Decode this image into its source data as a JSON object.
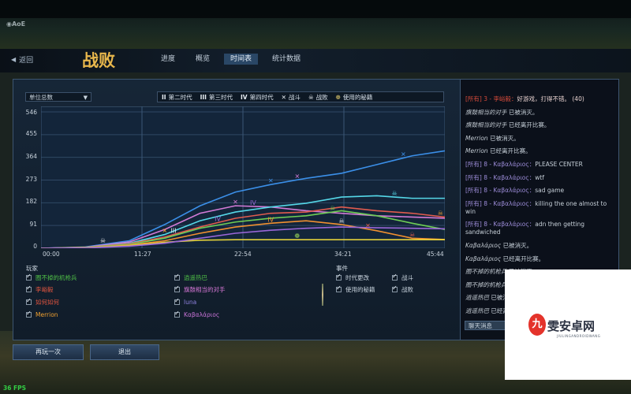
{
  "header": {
    "back_label": "返回",
    "title": "战败",
    "tabs": [
      {
        "label": "进度",
        "active": false
      },
      {
        "label": "概览",
        "active": false
      },
      {
        "label": "时间表",
        "active": true
      },
      {
        "label": "统计数据",
        "active": false
      }
    ]
  },
  "chart_controls": {
    "metric": "单位总数"
  },
  "legend": [
    {
      "glyph": "II",
      "label": "第二时代"
    },
    {
      "glyph": "III",
      "label": "第三时代"
    },
    {
      "glyph": "IV",
      "label": "第四时代"
    },
    {
      "glyph": "✕",
      "label": "战斗"
    },
    {
      "glyph": "☠",
      "label": "战败"
    },
    {
      "glyph": "❁",
      "label": "使用的秘籍"
    }
  ],
  "chart_data": {
    "type": "line",
    "x_ticks": [
      "00:00",
      "11:27",
      "22:54",
      "34:21",
      "45:44"
    ],
    "y_ticks": [
      0,
      91,
      182,
      273,
      364,
      455,
      546
    ],
    "xlim": [
      "00:00",
      "45:44"
    ],
    "ylim": [
      0,
      546
    ],
    "x_minutes": [
      0,
      5,
      10,
      14,
      18,
      22,
      26,
      30,
      34,
      38,
      42,
      45.7
    ],
    "series": [
      {
        "name": "Merrion",
        "color": "#3b8fe8",
        "values": [
          0,
          5,
          30,
          95,
          170,
          225,
          255,
          280,
          300,
          335,
          370,
          390
        ]
      },
      {
        "name": "Καβαλάριος",
        "color": "#d27ad6",
        "values": [
          0,
          4,
          25,
          75,
          140,
          170,
          165,
          150,
          140,
          130,
          125,
          120
        ]
      },
      {
        "name": "luna",
        "color": "#55d8e8",
        "values": [
          0,
          3,
          20,
          55,
          110,
          145,
          165,
          180,
          205,
          210,
          200,
          200
        ]
      },
      {
        "name": "旗鼓相当的对手",
        "color": "#e05b4e",
        "values": [
          0,
          3,
          18,
          45,
          85,
          120,
          140,
          145,
          165,
          150,
          140,
          125
        ]
      },
      {
        "name": "逍遥热巴",
        "color": "#6fce55",
        "values": [
          0,
          3,
          15,
          40,
          80,
          105,
          120,
          130,
          150,
          130,
          100,
          75
        ]
      },
      {
        "name": "李峪毅",
        "color": "#f09030",
        "values": [
          0,
          2,
          12,
          30,
          60,
          85,
          100,
          110,
          95,
          70,
          40,
          35
        ]
      },
      {
        "name": "如何如何",
        "color": "#e3d13a",
        "values": [
          0,
          2,
          10,
          24,
          32,
          34,
          34,
          34,
          34,
          34,
          34,
          34
        ]
      },
      {
        "name": "圈不掉的机枪兵",
        "color": "#9a66d8",
        "values": [
          0,
          1,
          8,
          20,
          40,
          60,
          72,
          80,
          85,
          82,
          80,
          78
        ]
      }
    ],
    "xlabel": "",
    "ylabel": "",
    "grid": true
  },
  "players_section": {
    "title": "玩家",
    "players": [
      {
        "name": "圈不掉的机枪兵",
        "color": "#4fc046"
      },
      {
        "name": "逍遥热巴",
        "color": "#4fc046"
      },
      {
        "name": "李峪毅",
        "color": "#e3553f"
      },
      {
        "name": "旗鼓相当的对手",
        "color": "#d878d8"
      },
      {
        "name": "如何如何",
        "color": "#e3553f"
      },
      {
        "name": "luna",
        "color": "#8f82e0"
      },
      {
        "name": "Merrion",
        "color": "#f0a030"
      },
      {
        "name": "Καβαλάριος",
        "color": "#c773d6"
      }
    ]
  },
  "events_section": {
    "title": "事件",
    "events": [
      {
        "label": "时代更改"
      },
      {
        "label": "战斗"
      },
      {
        "label": "使用的秘籍"
      },
      {
        "label": "战败"
      }
    ]
  },
  "buttons": {
    "replay": "再玩一次",
    "exit": "退出"
  },
  "chat": {
    "messages": [
      {
        "prefix": "[所有] 3 - 李峪毅：",
        "text": "好游戏，打得不错。 (40)",
        "style": "red"
      },
      {
        "name": "旗鼓相当的对手",
        "text": "已被消灭。"
      },
      {
        "name": "旗鼓相当的对手",
        "text": "已经离开比赛。"
      },
      {
        "name": "Merrion",
        "text": "已被消灭。"
      },
      {
        "name": "Merrion",
        "text": "已经离开比赛。"
      },
      {
        "prefix": "[所有] 8 - Καβαλάριος：",
        "text": "PLEASE CENTER",
        "style": "purple"
      },
      {
        "prefix": "[所有] 8 - Καβαλάριος：",
        "text": "wtf",
        "style": "purple"
      },
      {
        "prefix": "[所有] 8 - Καβαλάριος：",
        "text": "sad game",
        "style": "purple"
      },
      {
        "prefix": "[所有] 8 - Καβαλάριος：",
        "text": "killing the one almost to win",
        "style": "purple"
      },
      {
        "prefix": "[所有] 8 - Καβαλάριος：",
        "text": "adn then getting sandwiched",
        "style": "purple"
      },
      {
        "name": "Καβαλάριος",
        "text": "已被消灭。"
      },
      {
        "name": "Καβαλάριος",
        "text": "已经离开比赛。"
      },
      {
        "name": "圈不掉的机枪兵",
        "text": "已被消灭。"
      },
      {
        "name": "圈不掉的机枪兵",
        "text": "已经离开比赛。"
      },
      {
        "name": "逍遥热巴",
        "text": "已被消灭。"
      },
      {
        "name": "逍遥热巴",
        "text": "已经离开比赛。"
      }
    ],
    "input_label": "聊天消息"
  },
  "status": {
    "fps": "36 FPS"
  },
  "watermark": {
    "logo_text": "九",
    "title": "雯安卓网",
    "subtitle": "JIULINGANDROIDWANG"
  }
}
